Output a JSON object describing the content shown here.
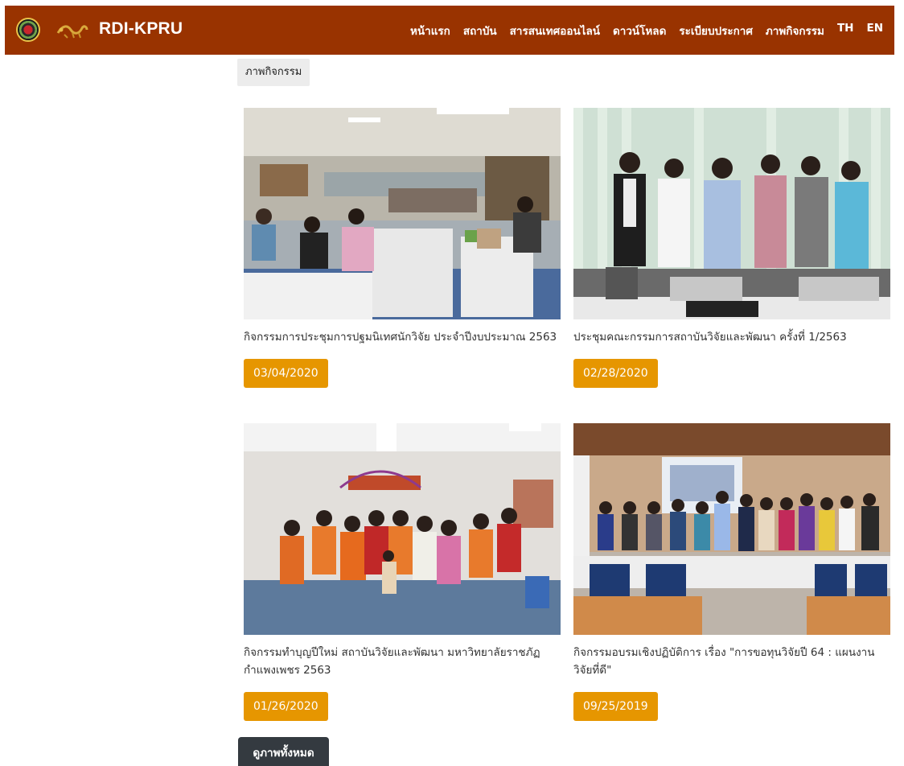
{
  "brand": "RDI-KPRU",
  "nav": {
    "home": "หน้าแรก",
    "institute": "สถาบัน",
    "online_info": "สารสนเทศออนไลน์",
    "download": "ดาวน์โหลด",
    "regulations": "ระเบียบประกาศ",
    "activities": "ภาพกิจกรรม",
    "lang_th": "TH",
    "lang_en": "EN"
  },
  "section_title": "ภาพกิจกรรม",
  "activities": [
    {
      "caption": "กิจกรรมการประชุมการปฐมนิเทศนักวิจัย ประจำปีงบประมาณ 2563",
      "date": "03/04/2020"
    },
    {
      "caption": "ประชุมคณะกรรมการสถาบันวิจัยและพัฒนา ครั้งที่ 1/2563",
      "date": "02/28/2020"
    },
    {
      "caption": "กิจกรรมทำบุญปีใหม่ สถาบันวิจัยและพัฒนา มหาวิทยาลัยราชภัฏกำแพงเพชร 2563",
      "date": "01/26/2020"
    },
    {
      "caption": "กิจกรรมอบรมเชิงปฏิบัติการ เรื่อง \"การขอทุนวิจัยปี 64 : แผนงานวิจัยที่ดี\"",
      "date": "09/25/2019"
    }
  ],
  "view_all_label": "ดูภาพทั้งหมด",
  "colors": {
    "navbar": "#993300",
    "date_button": "#e69600",
    "view_all_button": "#343a40",
    "section_tag_bg": "#ececec"
  }
}
